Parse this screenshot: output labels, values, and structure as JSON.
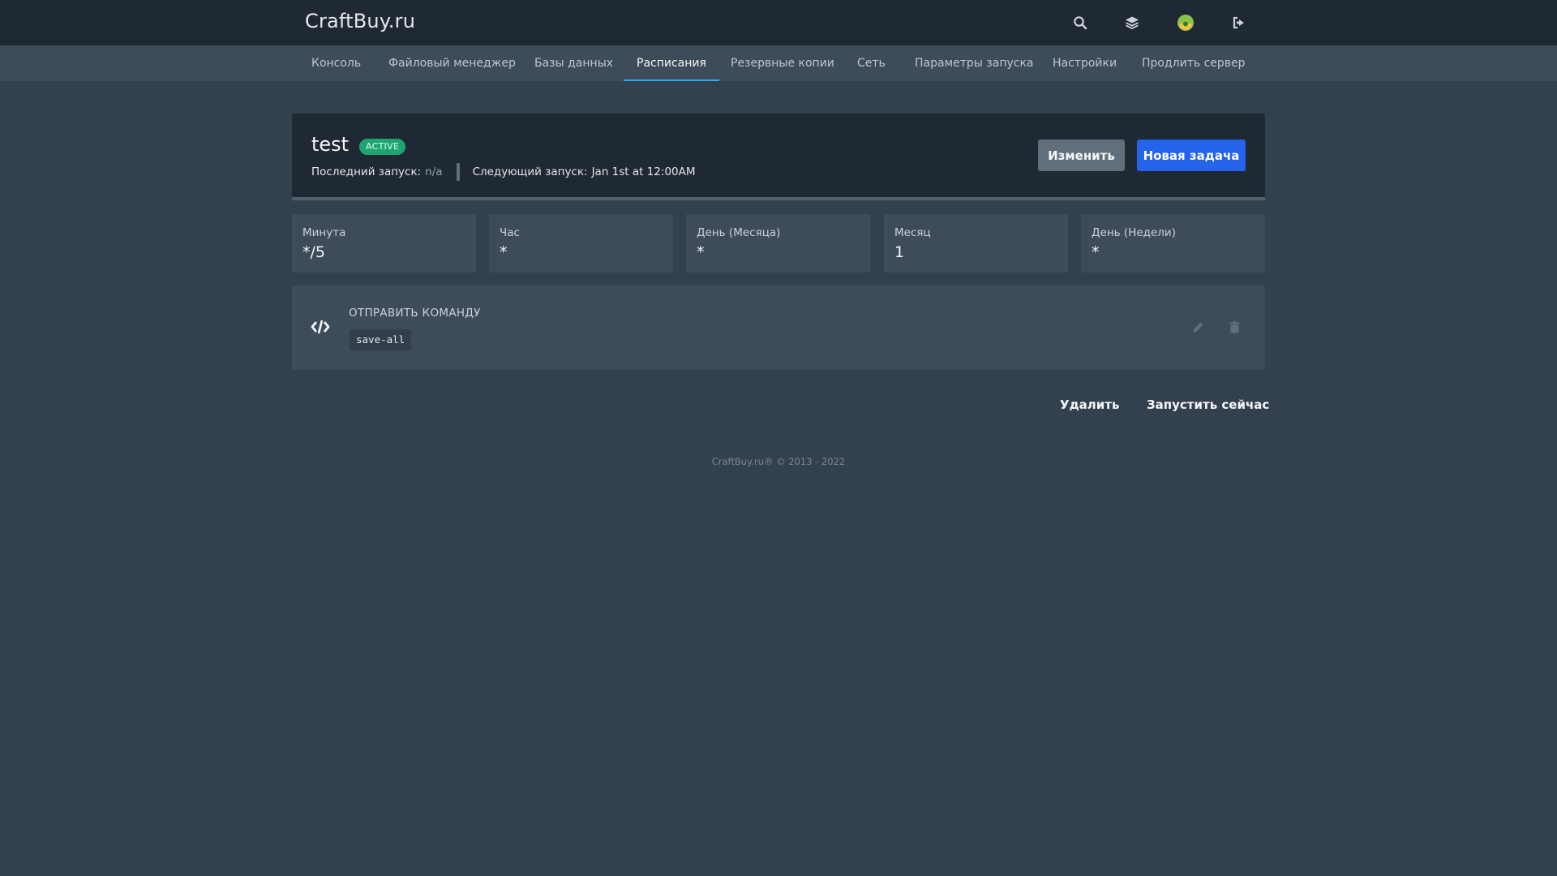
{
  "app": {
    "brand": "CraftBuy.ru",
    "top_icons": [
      "search-icon",
      "layers-icon",
      "avatar",
      "sign-out-icon"
    ]
  },
  "nav": {
    "tabs": [
      {
        "label": "Консоль",
        "active": false
      },
      {
        "label": "Файловый менеджер",
        "active": false
      },
      {
        "label": "Базы данных",
        "active": false
      },
      {
        "label": "Расписания",
        "active": true
      },
      {
        "label": "Резервные копии",
        "active": false
      },
      {
        "label": "Сеть",
        "active": false
      },
      {
        "label": "Параметры запуска",
        "active": false
      },
      {
        "label": "Настройки",
        "active": false
      },
      {
        "label": "Продлить сервер",
        "active": false
      }
    ]
  },
  "schedule": {
    "name": "test",
    "status": "ACTIVE",
    "last_run_label": "Последний запуск:",
    "last_run_value": "n/a",
    "next_run_label": "Следующий запуск:",
    "next_run_value": "Jan 1st at 12:00AM",
    "edit_label": "Изменить",
    "new_task_label": "Новая задача"
  },
  "cron": [
    {
      "label": "Минута",
      "value": "*/5"
    },
    {
      "label": "Час",
      "value": "*"
    },
    {
      "label": "День (Месяца)",
      "value": "*"
    },
    {
      "label": "Месяц",
      "value": "1"
    },
    {
      "label": "День (Недели)",
      "value": "*"
    }
  ],
  "task": {
    "icon": "code-icon",
    "title": "ОТПРАВИТЬ КОМАНДУ",
    "command": "save-all",
    "actions": [
      "pencil-icon",
      "trash-icon"
    ]
  },
  "actions": {
    "delete_label": "Удалить",
    "run_now_label": "Запустить сейчас"
  },
  "footer": {
    "text": "CraftBuy.ru® © 2013 - 2022"
  },
  "colors": {
    "background": "#33404d",
    "topbar": "#1f2933",
    "nav": "#3e4c59",
    "active_tab_underline": "#2bb0ed",
    "badge_active": "#1ea672",
    "primary_button": "#2563eb",
    "secondary_button": "#616e7c"
  }
}
